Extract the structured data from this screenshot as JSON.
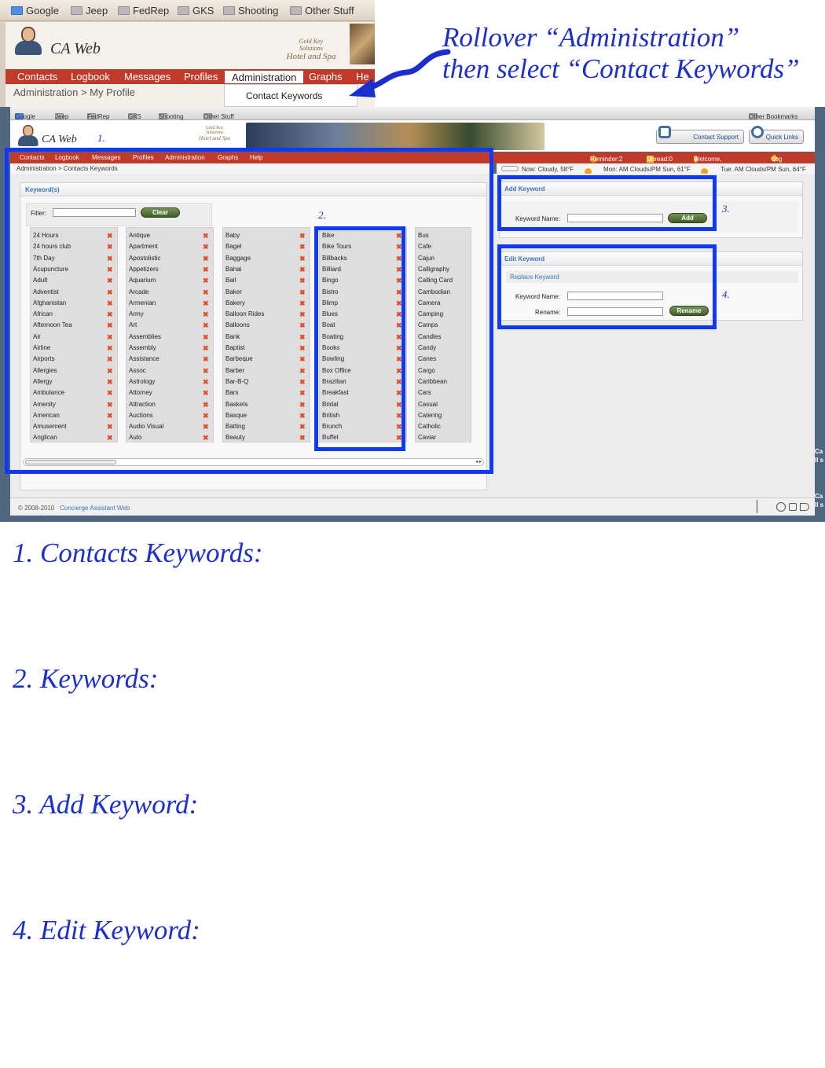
{
  "crop": {
    "bookmarks": [
      "Google",
      "Jeep",
      "FedRep",
      "GKS",
      "Shooting",
      "Other Stuff"
    ],
    "app_title": "CA Web",
    "logo_text_1": "Gold Key",
    "logo_text_2": "Solutions",
    "logo_text_3": "Hotel and Spa",
    "nav": [
      "Contacts",
      "Logbook",
      "Messages",
      "Profiles",
      "Administration",
      "Graphs",
      "He"
    ],
    "breadcrumb": "Administration > My Profile",
    "dropdown_item": "Contact Keywords"
  },
  "annotation": {
    "line1": "Rollover “Administration”",
    "line2": "then select “Contact Keywords”"
  },
  "main": {
    "bookmarks": [
      "Google",
      "Jeep",
      "FedRep",
      "GKS",
      "Shooting",
      "Other Stuff"
    ],
    "other_bookmarks": "Other Bookmarks",
    "app_title": "CA Web",
    "logo_text_1": "Gold Key",
    "logo_text_2": "Solutions",
    "logo_text_3": "Hotel and Spa",
    "contact_support": "Contact Support",
    "quick_links": "Quick Links",
    "nav": [
      "Contacts",
      "Logbook",
      "Messages",
      "Profiles",
      "Administration",
      "Graphs",
      "Help"
    ],
    "status": {
      "reminder": "Reminder:2",
      "unread": "Unread:0",
      "welcome": "Welcome, Adrian L.",
      "logout": "Log out"
    },
    "breadcrumb": "Administration > Contacts Keywords",
    "weather": {
      "now": "Now: Cloudy, 58°F",
      "mon": "Mon: AM Clouds/PM Sun, 61°F",
      "tue": "Tue: AM Clouds/PM Sun, 64°F"
    },
    "keywords_panel": {
      "title": "Keyword(s)",
      "filter_label": "Filter:",
      "filter_value": "",
      "clear": "Clear"
    },
    "keyword_columns": [
      [
        "24 Hours",
        "24 hours club",
        "7th Day",
        "Acupuncture",
        "Adult",
        "Adventist",
        "Afghanistan",
        "African",
        "Afternoon Tea",
        "Air",
        "Airline",
        "Airports",
        "Allergies",
        "Allergy",
        "Ambulance",
        "Amenity",
        "American",
        "Amusement",
        "Anglican"
      ],
      [
        "Antique",
        "Apartment",
        "Apostolistic",
        "Appetizers",
        "Aquarium",
        "Arcade",
        "Armenian",
        "Army",
        "Art",
        "Assemblies",
        "Assembly",
        "Assistance",
        "Assoc",
        "Astrology",
        "Attorney",
        "Attraction",
        "Auctions",
        "Audio Visual",
        "Auto"
      ],
      [
        "Baby",
        "Bagel",
        "Baggage",
        "Bahai",
        "Bail",
        "Baker",
        "Bakery",
        "Balloon Rides",
        "Balloons",
        "Bank",
        "Baptist",
        "Barbeque",
        "Barber",
        "Bar-B-Q",
        "Bars",
        "Baskets",
        "Basque",
        "Batting",
        "Beauty"
      ],
      [
        "Bike",
        "Bike Tours",
        "Billbacks",
        "Billiard",
        "Bingo",
        "Bistro",
        "Blimp",
        "Blues",
        "Boat",
        "Boating",
        "Books",
        "Bowling",
        "Box Office",
        "Brazilian",
        "Breakfast",
        "Bridal",
        "British",
        "Brunch",
        "Buffet"
      ],
      [
        "Bus",
        "Cafe",
        "Cajun",
        "Calligraphy",
        "Calling Card",
        "Cambodian",
        "Camera",
        "Camping",
        "Camps",
        "Candles",
        "Candy",
        "Canes",
        "Cargo",
        "Caribbean",
        "Cars",
        "Casual",
        "Catering",
        "Catholic",
        "Caviar"
      ]
    ],
    "add_panel": {
      "title": "Add Keyword",
      "name_label": "Keyword Name:",
      "name_value": "",
      "add": "Add"
    },
    "edit_panel": {
      "title": "Edit Keyword",
      "sub": "Replace Keyword",
      "name_label": "Keyword Name:",
      "name_value": "",
      "rename_label": "Rename:",
      "rename_value": "",
      "rename_btn": "Rename"
    },
    "footer": {
      "copyright": "© 2008-2010",
      "link": "Concierge Assistant Web"
    },
    "side_cut": [
      "Ca",
      "ll s",
      "Ca",
      "ll s"
    ],
    "markers": [
      "1.",
      "2.",
      "3.",
      "4."
    ]
  },
  "labels": [
    "1. Contacts Keywords:",
    "2. Keywords:",
    "3. Add Keyword:",
    "4. Edit Keyword:"
  ],
  "colors": {
    "nav_red": "#c13a29",
    "annotation_blue": "#1b2fd1",
    "highlight_blue": "#1039f4",
    "link_blue": "#3b73b8",
    "delete_x": "#e34b24",
    "button_green": "#4e6d33"
  }
}
